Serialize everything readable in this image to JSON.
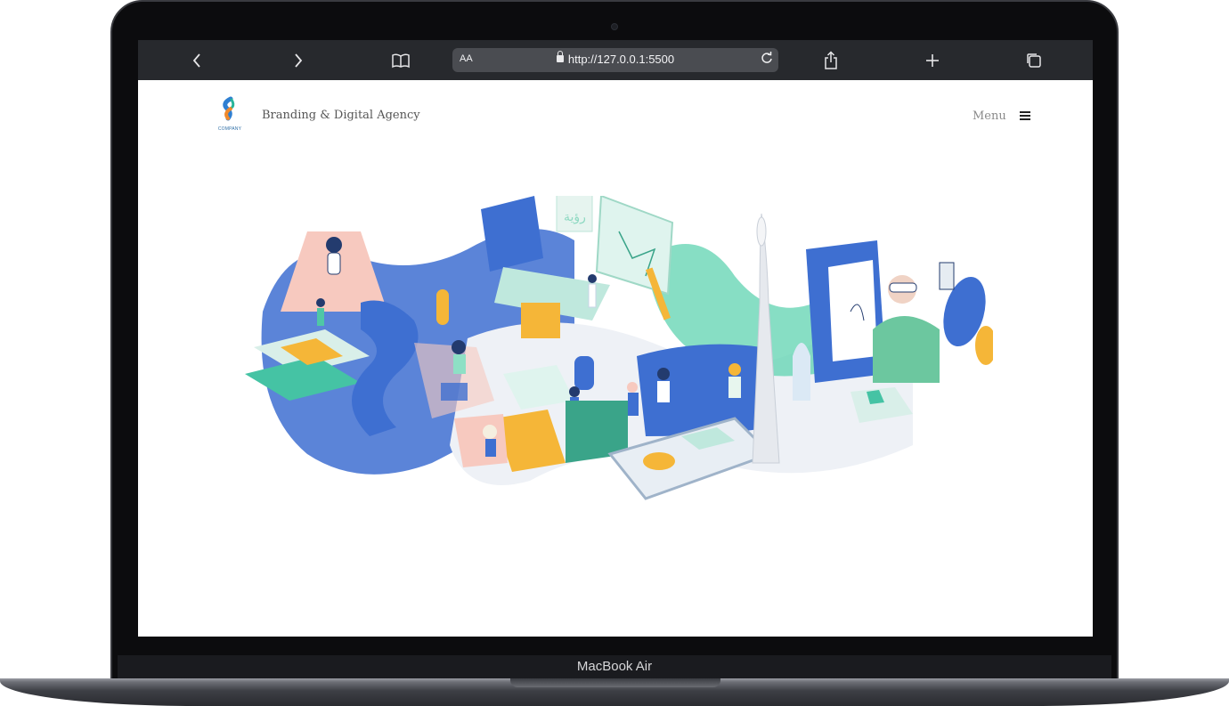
{
  "device": {
    "model_label": "MacBook Air"
  },
  "browser": {
    "text_size_label": "AA",
    "url": "http://127.0.0.1:5500",
    "icons": [
      "back-icon",
      "forward-icon",
      "bookmarks-icon",
      "lock-icon",
      "reload-icon",
      "share-icon",
      "new-tab-icon",
      "tabs-icon"
    ]
  },
  "site": {
    "logo_text": "COMPANY",
    "tagline": "Branding & Digital Agency",
    "menu_label": "Menu",
    "hero_sign_text": "رؤية",
    "colors": {
      "blue": "#3e6fd1",
      "mint": "#5fd3b0",
      "orange": "#f5b638",
      "peach": "#f7c9bf",
      "navy": "#233b6e"
    }
  }
}
